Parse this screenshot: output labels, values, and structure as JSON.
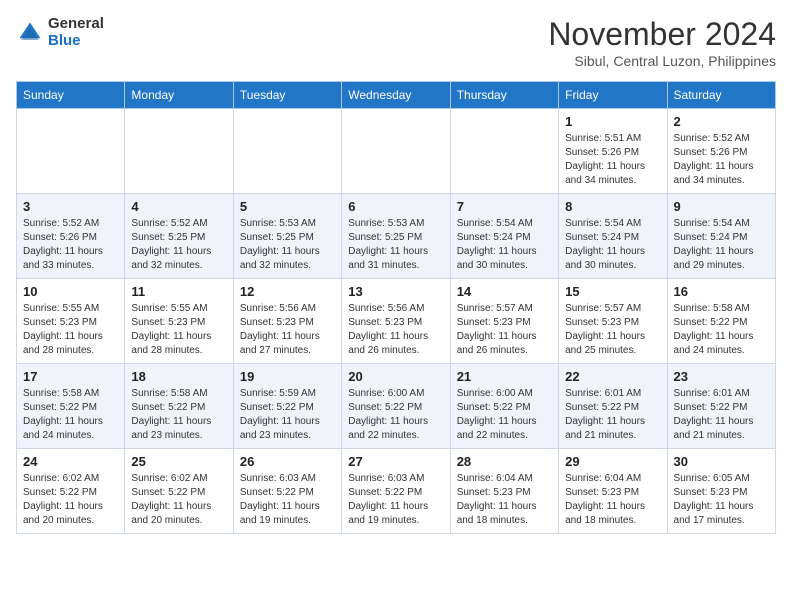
{
  "logo": {
    "general": "General",
    "blue": "Blue"
  },
  "title": "November 2024",
  "subtitle": "Sibul, Central Luzon, Philippines",
  "weekdays": [
    "Sunday",
    "Monday",
    "Tuesday",
    "Wednesday",
    "Thursday",
    "Friday",
    "Saturday"
  ],
  "weeks": [
    [
      {
        "day": "",
        "info": ""
      },
      {
        "day": "",
        "info": ""
      },
      {
        "day": "",
        "info": ""
      },
      {
        "day": "",
        "info": ""
      },
      {
        "day": "",
        "info": ""
      },
      {
        "day": "1",
        "info": "Sunrise: 5:51 AM\nSunset: 5:26 PM\nDaylight: 11 hours\nand 34 minutes."
      },
      {
        "day": "2",
        "info": "Sunrise: 5:52 AM\nSunset: 5:26 PM\nDaylight: 11 hours\nand 34 minutes."
      }
    ],
    [
      {
        "day": "3",
        "info": "Sunrise: 5:52 AM\nSunset: 5:26 PM\nDaylight: 11 hours\nand 33 minutes."
      },
      {
        "day": "4",
        "info": "Sunrise: 5:52 AM\nSunset: 5:25 PM\nDaylight: 11 hours\nand 32 minutes."
      },
      {
        "day": "5",
        "info": "Sunrise: 5:53 AM\nSunset: 5:25 PM\nDaylight: 11 hours\nand 32 minutes."
      },
      {
        "day": "6",
        "info": "Sunrise: 5:53 AM\nSunset: 5:25 PM\nDaylight: 11 hours\nand 31 minutes."
      },
      {
        "day": "7",
        "info": "Sunrise: 5:54 AM\nSunset: 5:24 PM\nDaylight: 11 hours\nand 30 minutes."
      },
      {
        "day": "8",
        "info": "Sunrise: 5:54 AM\nSunset: 5:24 PM\nDaylight: 11 hours\nand 30 minutes."
      },
      {
        "day": "9",
        "info": "Sunrise: 5:54 AM\nSunset: 5:24 PM\nDaylight: 11 hours\nand 29 minutes."
      }
    ],
    [
      {
        "day": "10",
        "info": "Sunrise: 5:55 AM\nSunset: 5:23 PM\nDaylight: 11 hours\nand 28 minutes."
      },
      {
        "day": "11",
        "info": "Sunrise: 5:55 AM\nSunset: 5:23 PM\nDaylight: 11 hours\nand 28 minutes."
      },
      {
        "day": "12",
        "info": "Sunrise: 5:56 AM\nSunset: 5:23 PM\nDaylight: 11 hours\nand 27 minutes."
      },
      {
        "day": "13",
        "info": "Sunrise: 5:56 AM\nSunset: 5:23 PM\nDaylight: 11 hours\nand 26 minutes."
      },
      {
        "day": "14",
        "info": "Sunrise: 5:57 AM\nSunset: 5:23 PM\nDaylight: 11 hours\nand 26 minutes."
      },
      {
        "day": "15",
        "info": "Sunrise: 5:57 AM\nSunset: 5:23 PM\nDaylight: 11 hours\nand 25 minutes."
      },
      {
        "day": "16",
        "info": "Sunrise: 5:58 AM\nSunset: 5:22 PM\nDaylight: 11 hours\nand 24 minutes."
      }
    ],
    [
      {
        "day": "17",
        "info": "Sunrise: 5:58 AM\nSunset: 5:22 PM\nDaylight: 11 hours\nand 24 minutes."
      },
      {
        "day": "18",
        "info": "Sunrise: 5:58 AM\nSunset: 5:22 PM\nDaylight: 11 hours\nand 23 minutes."
      },
      {
        "day": "19",
        "info": "Sunrise: 5:59 AM\nSunset: 5:22 PM\nDaylight: 11 hours\nand 23 minutes."
      },
      {
        "day": "20",
        "info": "Sunrise: 6:00 AM\nSunset: 5:22 PM\nDaylight: 11 hours\nand 22 minutes."
      },
      {
        "day": "21",
        "info": "Sunrise: 6:00 AM\nSunset: 5:22 PM\nDaylight: 11 hours\nand 22 minutes."
      },
      {
        "day": "22",
        "info": "Sunrise: 6:01 AM\nSunset: 5:22 PM\nDaylight: 11 hours\nand 21 minutes."
      },
      {
        "day": "23",
        "info": "Sunrise: 6:01 AM\nSunset: 5:22 PM\nDaylight: 11 hours\nand 21 minutes."
      }
    ],
    [
      {
        "day": "24",
        "info": "Sunrise: 6:02 AM\nSunset: 5:22 PM\nDaylight: 11 hours\nand 20 minutes."
      },
      {
        "day": "25",
        "info": "Sunrise: 6:02 AM\nSunset: 5:22 PM\nDaylight: 11 hours\nand 20 minutes."
      },
      {
        "day": "26",
        "info": "Sunrise: 6:03 AM\nSunset: 5:22 PM\nDaylight: 11 hours\nand 19 minutes."
      },
      {
        "day": "27",
        "info": "Sunrise: 6:03 AM\nSunset: 5:22 PM\nDaylight: 11 hours\nand 19 minutes."
      },
      {
        "day": "28",
        "info": "Sunrise: 6:04 AM\nSunset: 5:23 PM\nDaylight: 11 hours\nand 18 minutes."
      },
      {
        "day": "29",
        "info": "Sunrise: 6:04 AM\nSunset: 5:23 PM\nDaylight: 11 hours\nand 18 minutes."
      },
      {
        "day": "30",
        "info": "Sunrise: 6:05 AM\nSunset: 5:23 PM\nDaylight: 11 hours\nand 17 minutes."
      }
    ]
  ]
}
